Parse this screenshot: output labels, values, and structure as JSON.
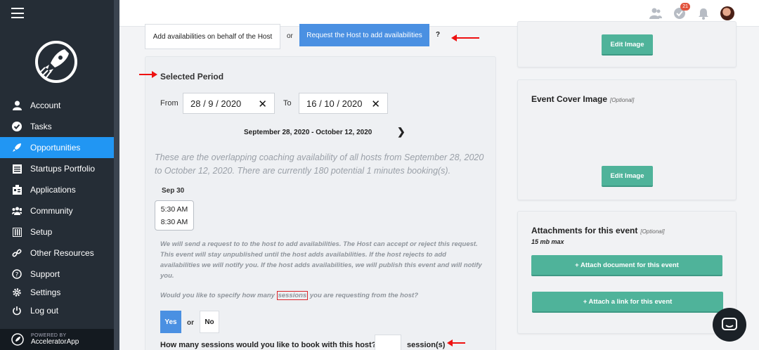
{
  "sidebar": {
    "items": [
      {
        "label": "Account",
        "icon": "user-icon"
      },
      {
        "label": "Tasks",
        "icon": "check-circle-icon"
      },
      {
        "label": "Opportunities",
        "icon": "rocket-icon"
      },
      {
        "label": "Startups Portfolio",
        "icon": "portfolio-icon"
      },
      {
        "label": "Applications",
        "icon": "applications-icon"
      },
      {
        "label": "Community",
        "icon": "community-icon"
      },
      {
        "label": "Setup",
        "icon": "sliders-icon"
      },
      {
        "label": "Other Resources",
        "icon": "link-icon"
      },
      {
        "label": "Support",
        "icon": "help-icon"
      },
      {
        "label": "Settings",
        "icon": "gear-icon"
      },
      {
        "label": "Log out",
        "icon": "power-icon"
      }
    ],
    "active": "Opportunities",
    "powered_by": "POWERED BY",
    "brand": "AcceleratorApp"
  },
  "topbar": {
    "notification_count": "21"
  },
  "request": {
    "behalf_button": "Add availabilities on behalf of the Host",
    "or": "or",
    "request_button": "Request the Host to add availabilities",
    "help": "?"
  },
  "period": {
    "title": "Selected Period",
    "from_label": "From",
    "from_value": "28 / 9 / 2020",
    "to_label": "To",
    "to_value": "16 / 10 / 2020",
    "range": "September 28, 2020 - October 12, 2020",
    "overlap_text": "These are the overlapping coaching availability of all hosts from September 28, 2020 to October 12, 2020. There are currently 180 potential 1 minutes booking(s).",
    "day": "Sep 30",
    "slots": [
      "5:30 AM",
      "8:30 AM"
    ],
    "request_note": "We will send a request to to the host to add availabilities. The Host can accept or reject this request. This event will stay unpublished until the host adds availabilities. If the host rejects to add availabilities we will notify you. If the host adds availabilities, we will publish this event and will notify you.",
    "specify_before": "Would you like to specify how many",
    "specify_highlight": "sessions",
    "specify_after": "you are requesting from the host?",
    "yes": "Yes",
    "or": "or",
    "no": "No",
    "how_many": "How many sessions would you like to book with this host?",
    "sessions_suffix": "session(s)"
  },
  "right": {
    "edit_image": "Edit Image",
    "cover_title": "Event Cover Image",
    "cover_optional": "[Optional]",
    "attach_title": "Attachments for this event",
    "attach_optional": "[Optional]",
    "attach_max": "15 mb max",
    "attach_doc": "+ Attach document for this event",
    "attach_link": "+ Attach a link for this event"
  },
  "colors": {
    "sidebar_bg": "#252d36",
    "active": "#2196f3",
    "primary_blue": "#4a90e2",
    "green": "#4fb39a",
    "annotation_red": "#e11111"
  }
}
